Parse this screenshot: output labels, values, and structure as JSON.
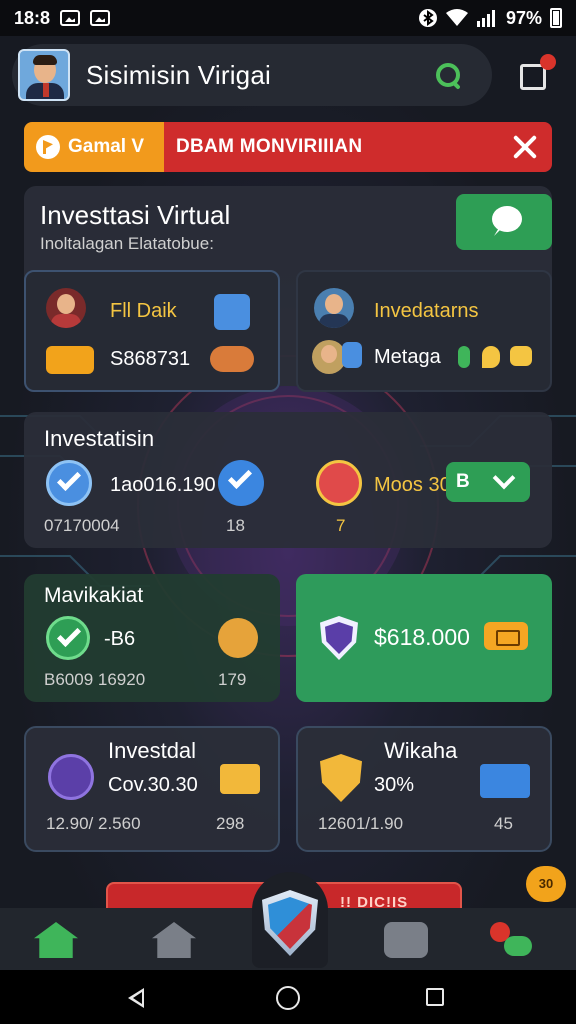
{
  "status_bar": {
    "time": "18:8",
    "battery": "97%"
  },
  "header": {
    "title": "Sisimisin Virigai"
  },
  "banner": {
    "tag": "Gamal V",
    "message": "DBAM MONVIRIIIAN"
  },
  "investasi_card": {
    "title": "Investtasi Virtual",
    "subtitle": "Inoltalagan Elatatobue:"
  },
  "mini_left": {
    "label": "Fll Daik",
    "value": "S868731"
  },
  "mini_right": {
    "label": "Invedatarns",
    "value": "Metaga"
  },
  "investatisin": {
    "title": "Investatisin",
    "value1": "1ao016.190",
    "sub1": "07170004",
    "sub2": "18",
    "label2": "Moos 30",
    "sub3": "7",
    "badge": "B"
  },
  "mavikakiat": {
    "title": "Mavikakiat",
    "value": "-B6",
    "sub1": "B6009 16920",
    "sub2": "179"
  },
  "green_card": {
    "value": "$618.000"
  },
  "investdal": {
    "title": "Investdal",
    "value": "Cov.30.30",
    "sub1": "12.90/ 2.560",
    "sub2": "298"
  },
  "wikaha": {
    "title": "Wikaha",
    "value": "30%",
    "sub1": "12601/1.90",
    "sub2": "45"
  },
  "float_badge": "30",
  "red_strip_text": "!! DIC!IS",
  "colors": {
    "accent_green": "#2e9e55",
    "banner_orange": "#f29a1c",
    "banner_red": "#cf2c2c",
    "gold": "#f4c542"
  }
}
